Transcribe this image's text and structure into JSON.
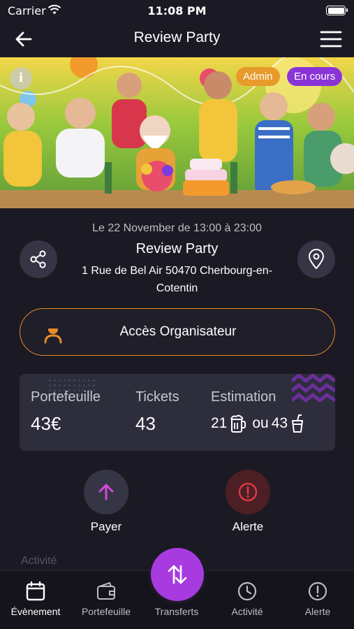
{
  "status_bar": {
    "carrier": "Carrier",
    "time": "11:08 PM"
  },
  "nav": {
    "title": "Review Party",
    "back_icon": "arrow-left-icon",
    "menu_icon": "hamburger-menu-icon"
  },
  "banner": {
    "info_label": "i",
    "badges": {
      "role": "Admin",
      "status": "En cours"
    },
    "colors": {
      "role": "#e89a2a",
      "status": "#8a34d8"
    }
  },
  "event": {
    "date_line": "Le 22 November de 13:00 à 23:00",
    "name": "Review Party",
    "address": "1 Rue de Bel Air 50470 Cherbourg-en-Cotentin",
    "share_icon": "share-icon",
    "location_icon": "map-pin-icon"
  },
  "organizer": {
    "label": "Accès Organisateur",
    "icon": "organizer-person-icon",
    "accent": "#e88a2c"
  },
  "stats": {
    "wallet_label": "Portefeuille",
    "wallet_value": "43€",
    "tickets_label": "Tickets",
    "tickets_value": "43",
    "estimation_label": "Estimation",
    "estimation_beer": "21",
    "estimation_or": "ou",
    "estimation_drink": "43"
  },
  "actions": {
    "pay": {
      "label": "Payer",
      "icon": "arrow-up-icon",
      "color": "#d64ad8"
    },
    "alert": {
      "label": "Alerte",
      "icon": "alert-circle-icon",
      "color": "#e03a44"
    }
  },
  "faded_heading": "Activité",
  "tabs": [
    {
      "label": "Évènement",
      "icon": "calendar-icon",
      "active": true
    },
    {
      "label": "Portefeuille",
      "icon": "wallet-icon",
      "active": false
    },
    {
      "label": "Transferts",
      "icon": "transfer-arrows-icon",
      "active": false
    },
    {
      "label": "Activité",
      "icon": "clock-icon",
      "active": false
    },
    {
      "label": "Alerte",
      "icon": "alert-circle-icon",
      "active": false
    }
  ]
}
